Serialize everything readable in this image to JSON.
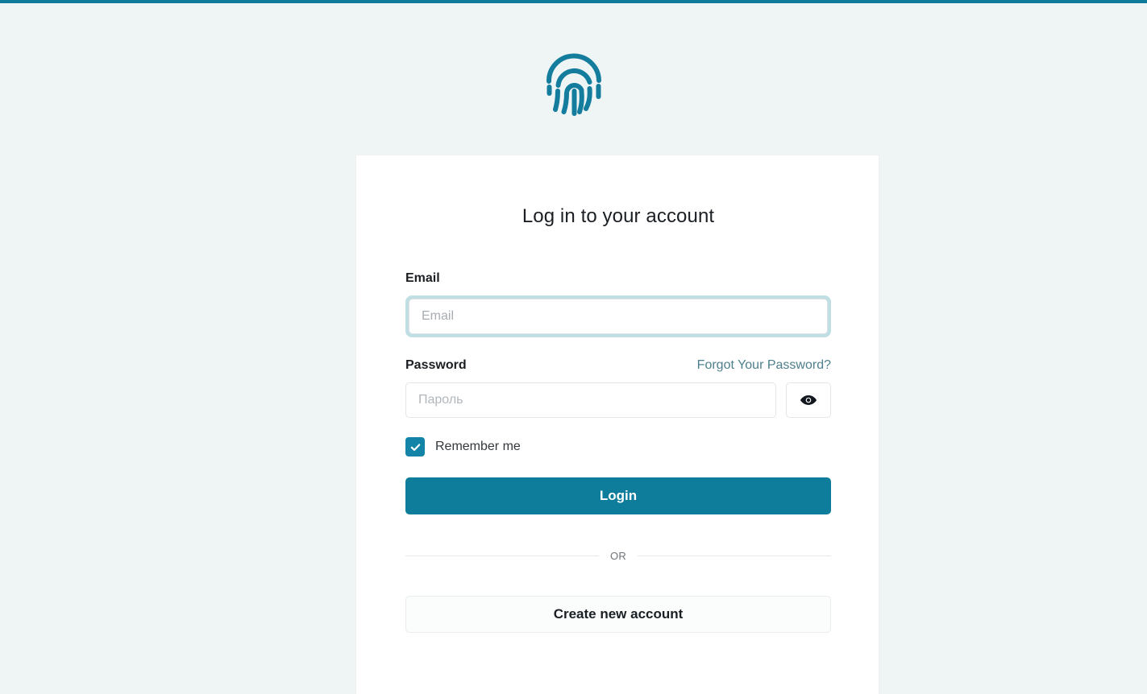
{
  "theme": {
    "accent_color": "#0e7c9b",
    "page_background": "#eff5f5",
    "card_background": "#ffffff",
    "focus_ring_color": "#bfdfe4",
    "link_color": "#4e7f8c",
    "checkbox_checked_color": "#1383a8"
  },
  "logo": {
    "icon": "fingerprint-icon",
    "color": "#147d9e"
  },
  "card": {
    "title": "Log in to your account",
    "email": {
      "label": "Email",
      "placeholder": "Email",
      "value": "",
      "focused": true
    },
    "password": {
      "label": "Password",
      "forgot_link": "Forgot Your Password?",
      "placeholder": "Пароль",
      "value": "",
      "toggle_icon": "eye-icon"
    },
    "remember": {
      "label": "Remember me",
      "checked": true,
      "check_glyph": "✔"
    },
    "login_button": "Login",
    "divider_text": "OR",
    "create_account_button": "Create new account"
  }
}
